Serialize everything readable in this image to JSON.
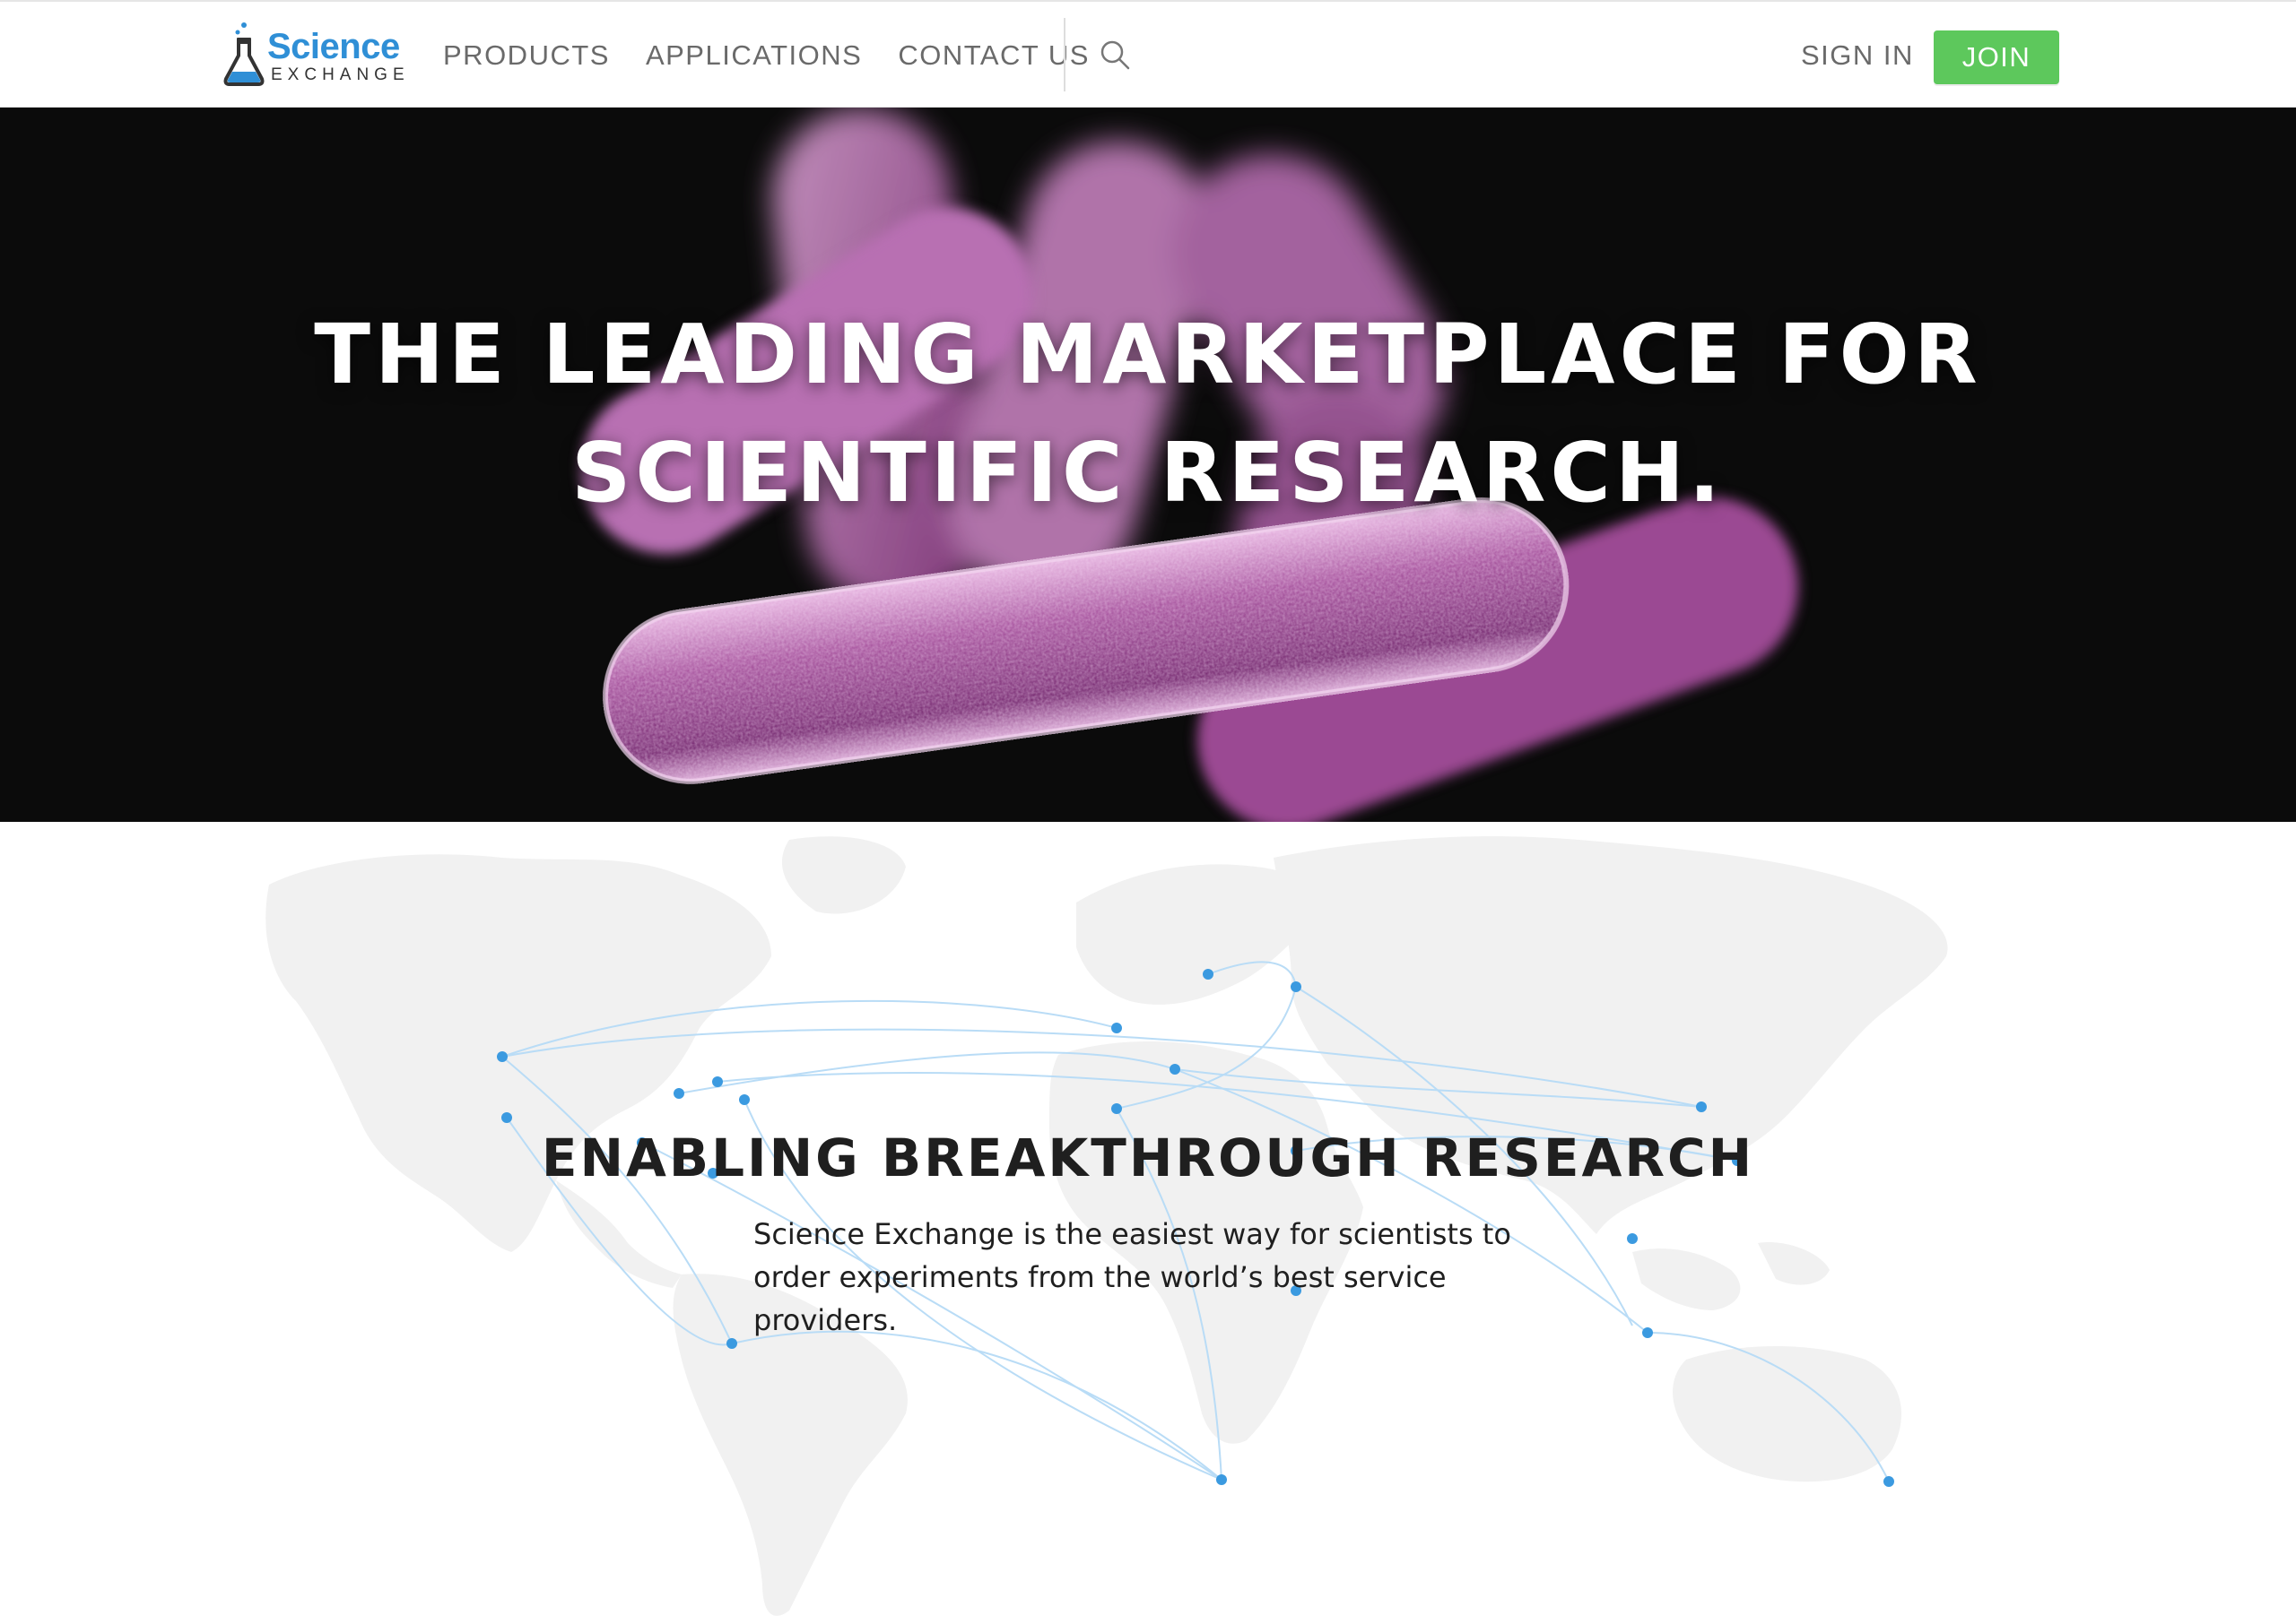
{
  "header": {
    "logo": {
      "word_top": "Science",
      "word_bottom": "EXCHANGE"
    },
    "nav": [
      "PRODUCTS",
      "APPLICATIONS",
      "CONTACT US"
    ],
    "search_icon": "search-icon",
    "sign_in_label": "SIGN IN",
    "join_label": "JOIN"
  },
  "hero": {
    "title_line1": "THE LEADING MARKETPLACE FOR",
    "title_line2": "SCIENTIFIC RESEARCH.",
    "image": "bacteria-microscopy-image"
  },
  "section": {
    "title": "ENABLING BREAKTHROUGH RESEARCH",
    "text": "Science Exchange is the easiest way for scientists to order experiments from the world’s best service providers.",
    "background": "world-map-with-connections"
  },
  "colors": {
    "brand_blue": "#2f8fd6",
    "join_green": "#5dc85c",
    "nav_gray": "#6a6a6a",
    "map_gray": "#f1f1f1",
    "dot_blue": "#3b9ae0",
    "line_blue": "#b9dcf6"
  }
}
